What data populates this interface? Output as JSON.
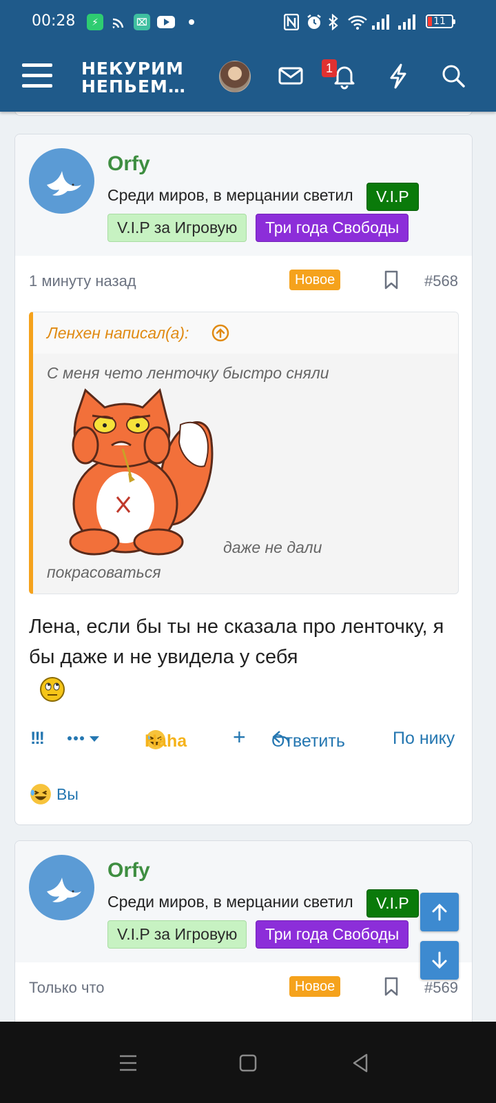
{
  "status_bar": {
    "time": "00:28",
    "battery": "11"
  },
  "header": {
    "logo_line1": "НЕКУРИМ",
    "logo_line2": "НЕПЬЕМ…",
    "notification_count": "1"
  },
  "posts": [
    {
      "username": "Orfy",
      "user_title": "Среди миров, в мерцании светил",
      "badges": [
        "V.I.P",
        "V.I.P за Игровую",
        "Три года Свободы"
      ],
      "time": "1 минуту назад",
      "new_label": "Новое",
      "number": "#568",
      "quote": {
        "author": "Ленхен написал(а):",
        "line1": "С меня чето ленточку быстро сняли",
        "line2": "даже не дали",
        "line3": "покрасоваться"
      },
      "body": "Лена, если бы ты не сказала про ленточку, я бы даже и не увидела у себя",
      "actions": {
        "bang": "!!!",
        "reaction": "Haha",
        "plus": "+",
        "reply": "Ответить",
        "by_nick": "По нику"
      },
      "reacted_by": "Вы"
    },
    {
      "username": "Orfy",
      "user_title": "Среди миров, в мерцании светил",
      "badges": [
        "V.I.P",
        "V.I.P за Игровую",
        "Три года Свободы"
      ],
      "time": "Только что",
      "new_label": "Новое",
      "number": "#569"
    }
  ],
  "colors": {
    "header_bg": "#1f5a8a",
    "username": "#3e8e41",
    "link": "#2577b1",
    "new_badge": "#f5a21c",
    "vip": "#0a7a0a",
    "freedom": "#8c2ed9"
  }
}
